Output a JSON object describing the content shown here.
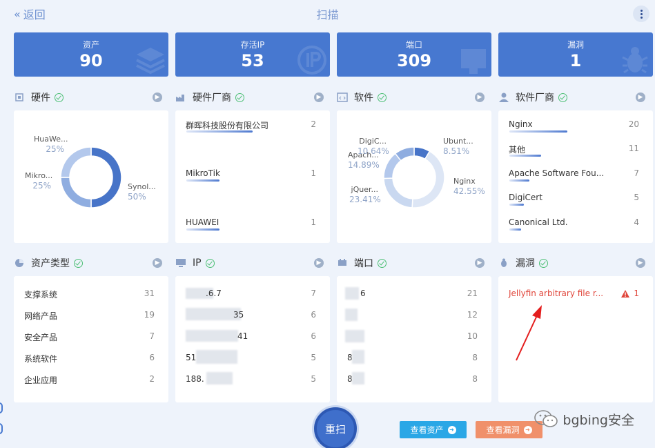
{
  "nav": {
    "back_label": "返回",
    "title": "扫描"
  },
  "stats": [
    {
      "label": "资产",
      "value": "90",
      "icon": "layers-icon"
    },
    {
      "label": "存活IP",
      "value": "53",
      "icon": "ip-icon"
    },
    {
      "label": "端口",
      "value": "309",
      "icon": "port-icon"
    },
    {
      "label": "漏洞",
      "value": "1",
      "icon": "bug-icon"
    }
  ],
  "sections": {
    "hardware": "硬件",
    "hardware_vendor": "硬件厂商",
    "software": "软件",
    "software_vendor": "软件厂商",
    "asset_type": "资产类型",
    "ip": "IP",
    "port": "端口",
    "vuln": "漏洞"
  },
  "hardware_donut": {
    "segments": [
      {
        "name": "HuaWe...",
        "pct": "25%",
        "value": 25,
        "color": "#b3c8ec"
      },
      {
        "name": "Mikro...",
        "pct": "25%",
        "value": 25,
        "color": "#8fade0"
      },
      {
        "name": "Synol...",
        "pct": "50%",
        "value": 50,
        "color": "#4774c8"
      }
    ]
  },
  "hardware_vendors": [
    {
      "name": "群晖科技股份有限公司",
      "count": "2",
      "share": 1.0
    },
    {
      "name": "MikroTik",
      "count": "1",
      "share": 0.5
    },
    {
      "name": "HUAWEI",
      "count": "1",
      "share": 0.5
    }
  ],
  "software_donut": {
    "segments": [
      {
        "name": "Ubunt...",
        "pct": "8.51%",
        "value": 8.51,
        "color": "#4774c8"
      },
      {
        "name": "Nginx",
        "pct": "42.55%",
        "value": 42.55,
        "color": "#dde6f5"
      },
      {
        "name": "jQuer...",
        "pct": "23.41%",
        "value": 23.41,
        "color": "#c9d8f0"
      },
      {
        "name": "Apach...",
        "pct": "14.89%",
        "value": 14.89,
        "color": "#b3c8ec"
      },
      {
        "name": "DigiC...",
        "pct": "10.64%",
        "value": 10.64,
        "color": "#8fade0"
      }
    ]
  },
  "software_vendors": [
    {
      "name": "Nginx",
      "count": "20",
      "share": 1.0
    },
    {
      "name": "其他",
      "count": "11",
      "share": 0.55
    },
    {
      "name": "Apache Software Fou...",
      "count": "7",
      "share": 0.35
    },
    {
      "name": "DigiCert",
      "count": "5",
      "share": 0.25
    },
    {
      "name": "Canonical Ltd.",
      "count": "4",
      "share": 0.2
    }
  ],
  "asset_types": [
    {
      "name": "支撑系统",
      "count": "31"
    },
    {
      "name": "网络产品",
      "count": "19"
    },
    {
      "name": "安全产品",
      "count": "7"
    },
    {
      "name": "系统软件",
      "count": "6"
    },
    {
      "name": "企业应用",
      "count": "2"
    }
  ],
  "ips": [
    {
      "visible": ".6.7",
      "count": "7"
    },
    {
      "visible": "35",
      "count": "6"
    },
    {
      "visible": "41",
      "count": "6"
    },
    {
      "visible": "51",
      "count": "5"
    },
    {
      "visible": "188.",
      "count": "5"
    }
  ],
  "ports": [
    {
      "visible": "6",
      "count": "21"
    },
    {
      "visible": "",
      "count": "12"
    },
    {
      "visible": "",
      "count": "10"
    },
    {
      "visible": "8",
      "count": "8"
    },
    {
      "visible": "8",
      "count": "8"
    }
  ],
  "vulns": [
    {
      "name": "Jellyfin arbitrary file r...",
      "count": "1"
    }
  ],
  "actions": {
    "rescan": "重扫",
    "view_assets": "查看资产",
    "view_vulns": "查看漏洞"
  },
  "watermark": "bgbing安全",
  "colors": {
    "accent": "#4778d0",
    "ok": "#4cbf74",
    "vuln_red": "#e0453a",
    "assets_btn": "#2aa7e6",
    "vulns_btn": "#f0906a"
  }
}
